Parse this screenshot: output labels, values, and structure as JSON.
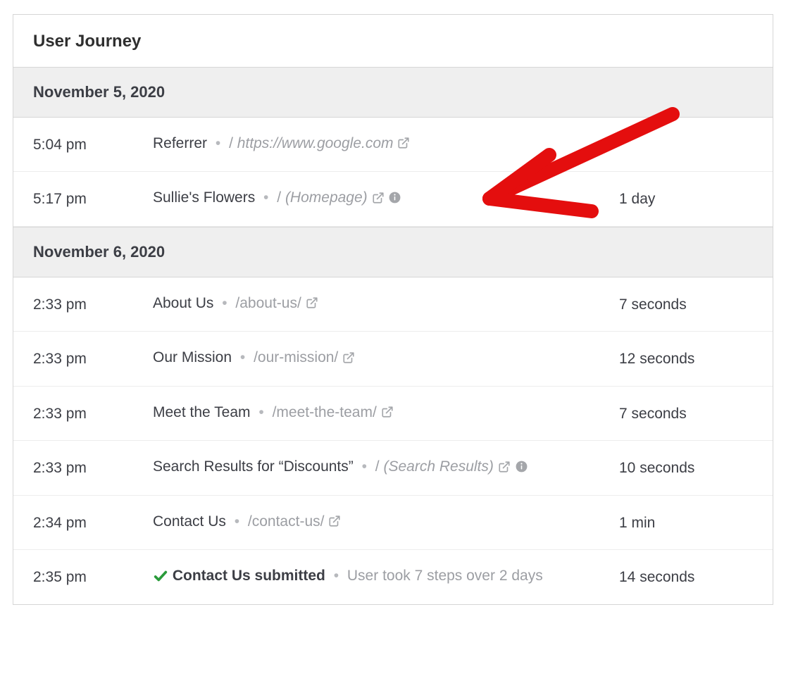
{
  "panel": {
    "title": "User Journey"
  },
  "groups": [
    {
      "date": "November 5, 2020",
      "rows": [
        {
          "time": "5:04 pm",
          "title": "Referrer",
          "slash": "/",
          "path": "https://www.google.com",
          "path_italic": true,
          "has_external": true,
          "has_info": false,
          "duration": "",
          "extra": "",
          "has_check": false,
          "submitted": false
        },
        {
          "time": "5:17 pm",
          "title": "Sullie's Flowers",
          "slash": "/",
          "path": "(Homepage)",
          "path_italic": true,
          "has_external": true,
          "has_info": true,
          "duration": "1 day",
          "extra": "",
          "has_check": false,
          "submitted": false
        }
      ]
    },
    {
      "date": "November 6, 2020",
      "rows": [
        {
          "time": "2:33 pm",
          "title": "About Us",
          "slash": "",
          "path": "/about-us/",
          "path_italic": false,
          "has_external": true,
          "has_info": false,
          "duration": "7 seconds",
          "extra": "",
          "has_check": false,
          "submitted": false
        },
        {
          "time": "2:33 pm",
          "title": "Our Mission",
          "slash": "",
          "path": "/our-mission/",
          "path_italic": false,
          "has_external": true,
          "has_info": false,
          "duration": "12 seconds",
          "extra": "",
          "has_check": false,
          "submitted": false
        },
        {
          "time": "2:33 pm",
          "title": "Meet the Team",
          "slash": "",
          "path": "/meet-the-team/",
          "path_italic": false,
          "has_external": true,
          "has_info": false,
          "duration": "7 seconds",
          "extra": "",
          "has_check": false,
          "submitted": false
        },
        {
          "time": "2:33 pm",
          "title": "Search Results for “Discounts”",
          "slash": "/",
          "path": "(Search Results)",
          "path_italic": true,
          "has_external": true,
          "has_info": true,
          "duration": "10 seconds",
          "extra": "",
          "has_check": false,
          "submitted": false
        },
        {
          "time": "2:34 pm",
          "title": "Contact Us",
          "slash": "",
          "path": "/contact-us/",
          "path_italic": false,
          "has_external": true,
          "has_info": false,
          "duration": "1 min",
          "extra": "",
          "has_check": false,
          "submitted": false
        },
        {
          "time": "2:35 pm",
          "title": "Contact Us submitted",
          "slash": "",
          "path": "",
          "path_italic": false,
          "has_external": false,
          "has_info": false,
          "duration": "14 seconds",
          "extra": "User took 7 steps over 2 days",
          "has_check": true,
          "submitted": true
        }
      ]
    }
  ]
}
